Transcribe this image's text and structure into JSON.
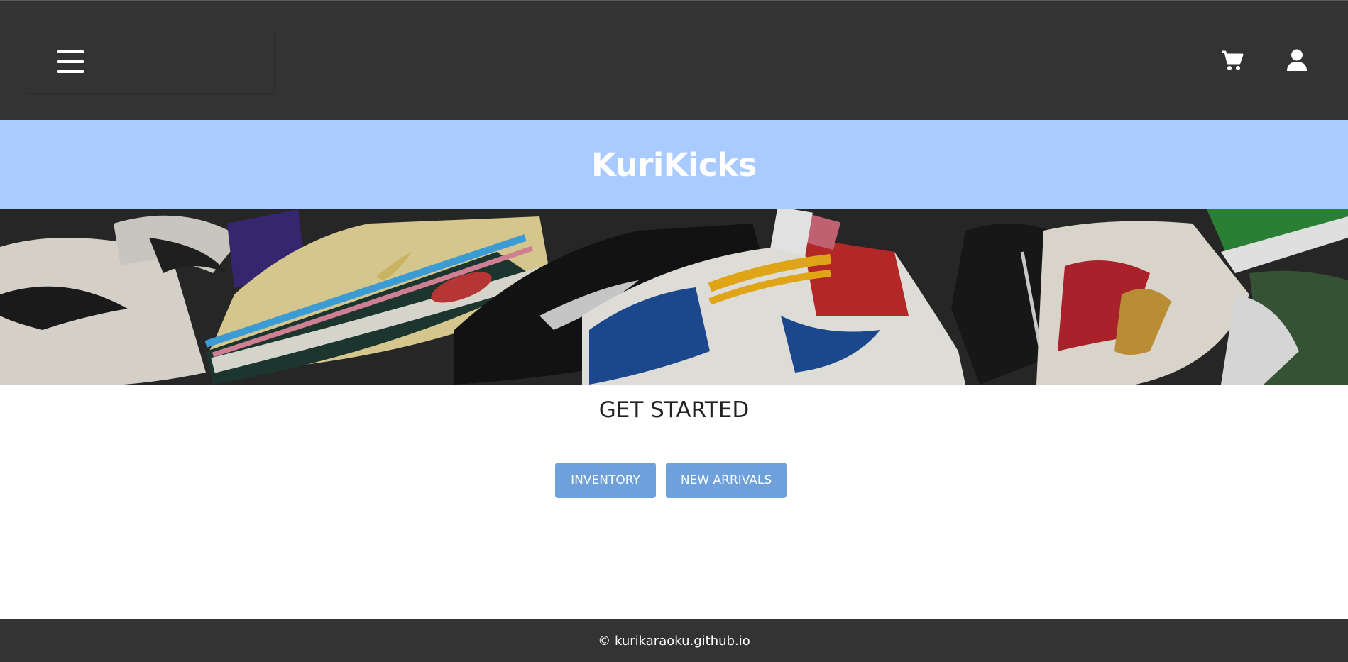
{
  "header": {
    "menu_icon": "hamburger-icon",
    "cart_icon": "cart-icon",
    "account_icon": "user-icon"
  },
  "brand": {
    "title": "KuriKicks",
    "banner_color": "#a9cbff"
  },
  "hero": {
    "image_alt": "sneakers-collage"
  },
  "main": {
    "heading": "GET STARTED",
    "buttons": [
      {
        "label": "INVENTORY"
      },
      {
        "label": "NEW ARRIVALS"
      }
    ],
    "button_color": "#6ea0dc"
  },
  "footer": {
    "text": "© kurikaraoku.github.io"
  }
}
